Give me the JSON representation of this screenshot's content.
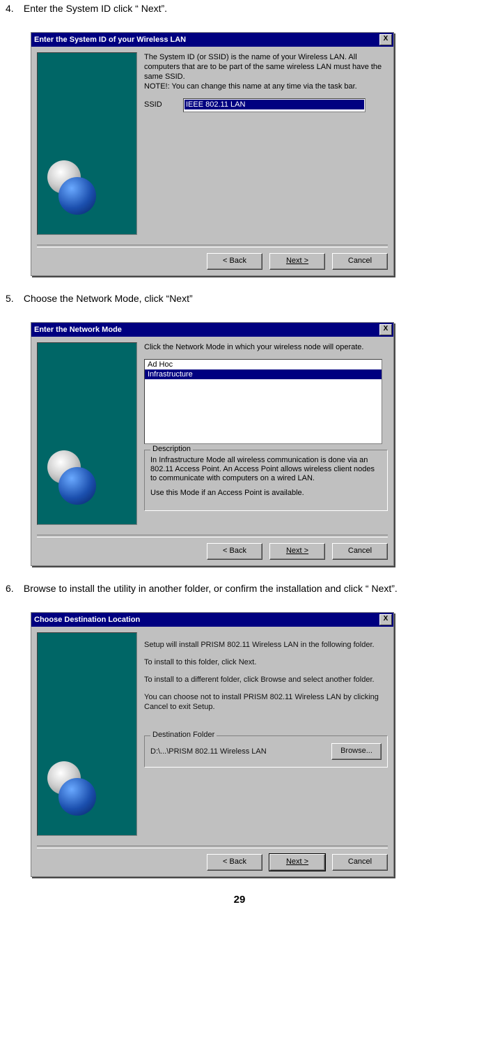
{
  "steps": {
    "s4": {
      "num": "4.",
      "text": "Enter the System ID click “ Next”."
    },
    "s5": {
      "num": "5.",
      "text": "Choose the Network Mode, click “Next”"
    },
    "s6": {
      "num": "6.",
      "text": "Browse to install the utility in another folder, or confirm the installation and click “ Next”."
    }
  },
  "dialog1": {
    "title": "Enter the System ID of your Wireless LAN",
    "close": "X",
    "info": "The System ID (or SSID) is the name of your Wireless LAN.  All computers that are to be part of the same wireless LAN must have the same SSID.\nNOTE!: You can change this name at any time via the task bar.",
    "ssid_label": "SSID",
    "ssid_value": "IEEE 802.11 LAN",
    "buttons": {
      "back": "< Back",
      "next": "Next >",
      "cancel": "Cancel"
    }
  },
  "dialog2": {
    "title": "Enter the Network Mode",
    "close": "X",
    "info": "Click the Network Mode in which your wireless node will operate.",
    "options": [
      "Ad Hoc",
      "Infrastructure"
    ],
    "selected_index": 1,
    "group_title": "Description",
    "desc_p1": "In Infrastructure Mode all wireless communication is done via an 802.11 Access Point.  An Access Point allows wireless client nodes to communicate with computers on a wired LAN.",
    "desc_p2": "Use this Mode if an Access Point is available.",
    "buttons": {
      "back": "< Back",
      "next": "Next >",
      "cancel": "Cancel"
    }
  },
  "dialog3": {
    "title": "Choose Destination Location",
    "close": "X",
    "p1": "Setup will install PRISM 802.11 Wireless LAN in the following folder.",
    "p2": "To install to this folder, click Next.",
    "p3": "To install to a different folder, click Browse and select another folder.",
    "p4": "You can choose not to install PRISM 802.11 Wireless LAN by clicking Cancel to exit Setup.",
    "group_title": "Destination Folder",
    "path": "D:\\...\\PRISM 802.11 Wireless LAN",
    "browse": "Browse...",
    "buttons": {
      "back": "< Back",
      "next": "Next >",
      "cancel": "Cancel"
    }
  },
  "page_number": "29"
}
